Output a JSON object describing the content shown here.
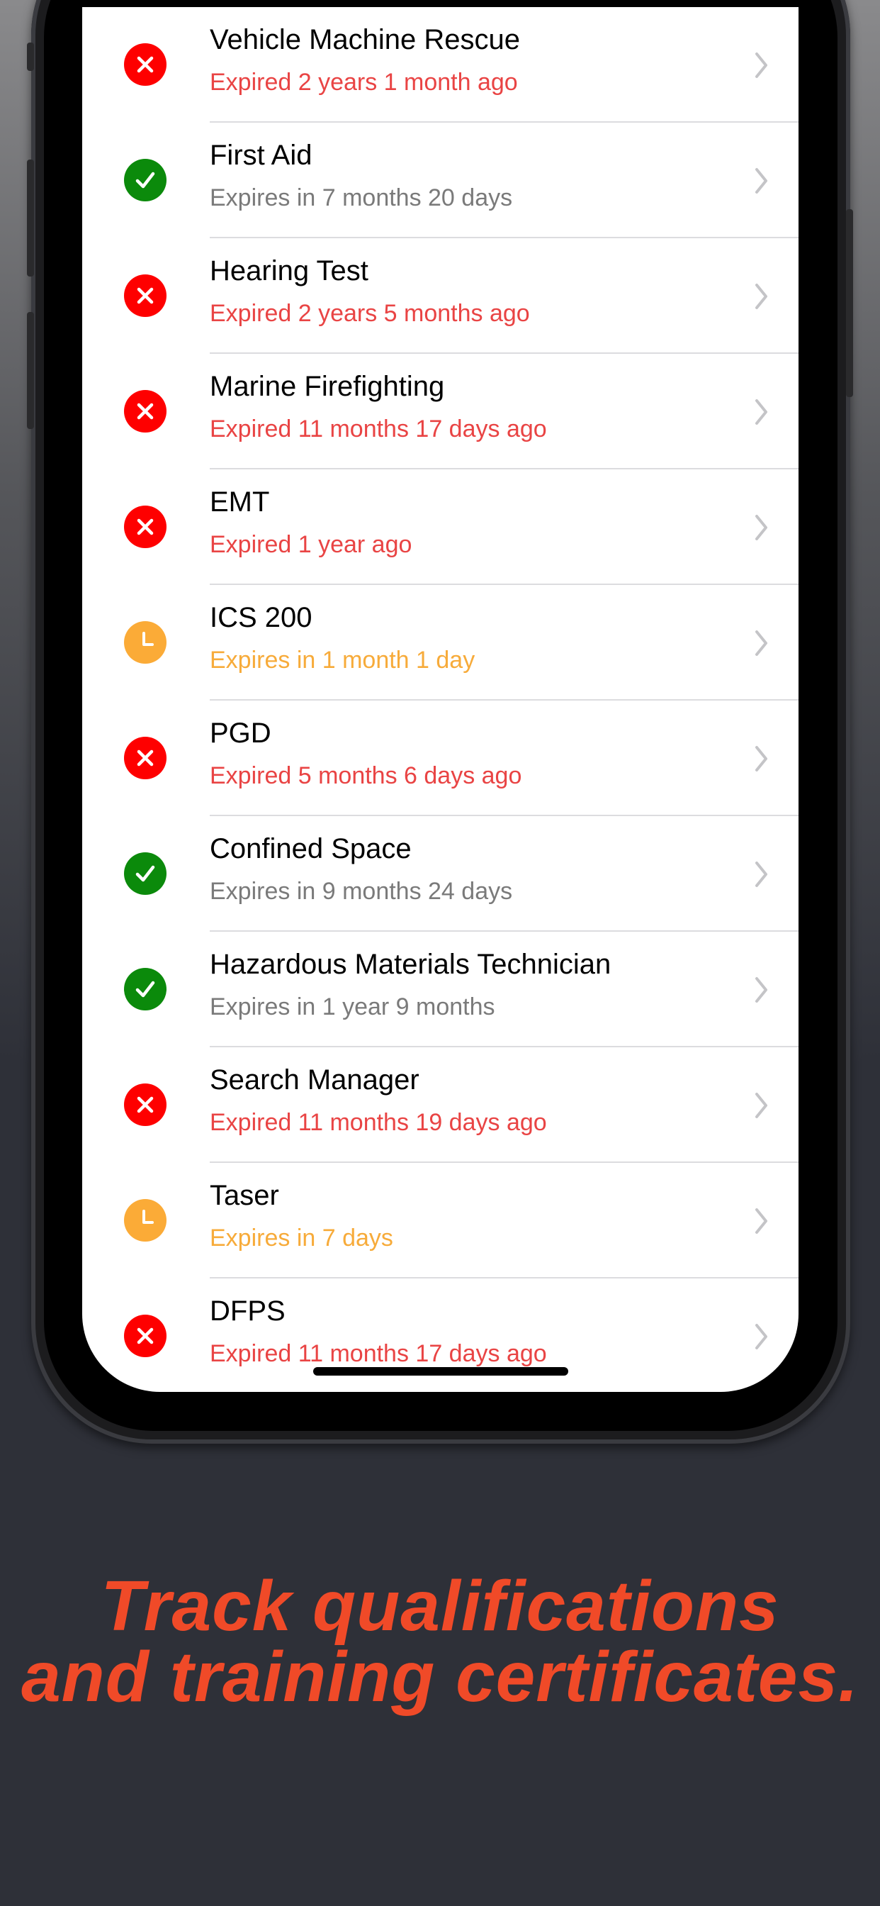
{
  "colors": {
    "expired": "#fe0000",
    "valid": "#0b8a0b",
    "warning": "#fbab37",
    "expired_text": "#e94444",
    "valid_text": "#7a7a7a",
    "warning_text": "#f7ab3a",
    "caption": "#f04a28"
  },
  "items": [
    {
      "title": "Vehicle Machine Rescue",
      "subtitle": "Expired 2 years 1 month ago",
      "status": "expired",
      "icon": "x-circle-icon"
    },
    {
      "title": "First Aid",
      "subtitle": "Expires in 7 months 20 days",
      "status": "valid",
      "icon": "checkmark-circle-icon"
    },
    {
      "title": "Hearing Test",
      "subtitle": "Expired 2 years 5 months ago",
      "status": "expired",
      "icon": "x-circle-icon"
    },
    {
      "title": "Marine Firefighting",
      "subtitle": "Expired 11 months 17 days ago",
      "status": "expired",
      "icon": "x-circle-icon"
    },
    {
      "title": "EMT",
      "subtitle": "Expired 1 year ago",
      "status": "expired",
      "icon": "x-circle-icon"
    },
    {
      "title": "ICS 200",
      "subtitle": "Expires in 1 month 1 day",
      "status": "warning",
      "icon": "clock-circle-icon"
    },
    {
      "title": "PGD",
      "subtitle": "Expired 5 months 6 days ago",
      "status": "expired",
      "icon": "x-circle-icon"
    },
    {
      "title": "Confined Space",
      "subtitle": "Expires in 9 months 24 days",
      "status": "valid",
      "icon": "checkmark-circle-icon"
    },
    {
      "title": "Hazardous Materials Technician",
      "subtitle": "Expires in 1 year 9 months",
      "status": "valid",
      "icon": "checkmark-circle-icon"
    },
    {
      "title": "Search Manager",
      "subtitle": "Expired 11 months 19 days ago",
      "status": "expired",
      "icon": "x-circle-icon"
    },
    {
      "title": "Taser",
      "subtitle": "Expires in 7 days",
      "status": "warning",
      "icon": "clock-circle-icon"
    },
    {
      "title": "DFPS",
      "subtitle": "Expired 11 months 17 days ago",
      "status": "expired",
      "icon": "x-circle-icon"
    }
  ],
  "caption": {
    "line1": "Track qualifications",
    "line2": "and training certificates."
  }
}
